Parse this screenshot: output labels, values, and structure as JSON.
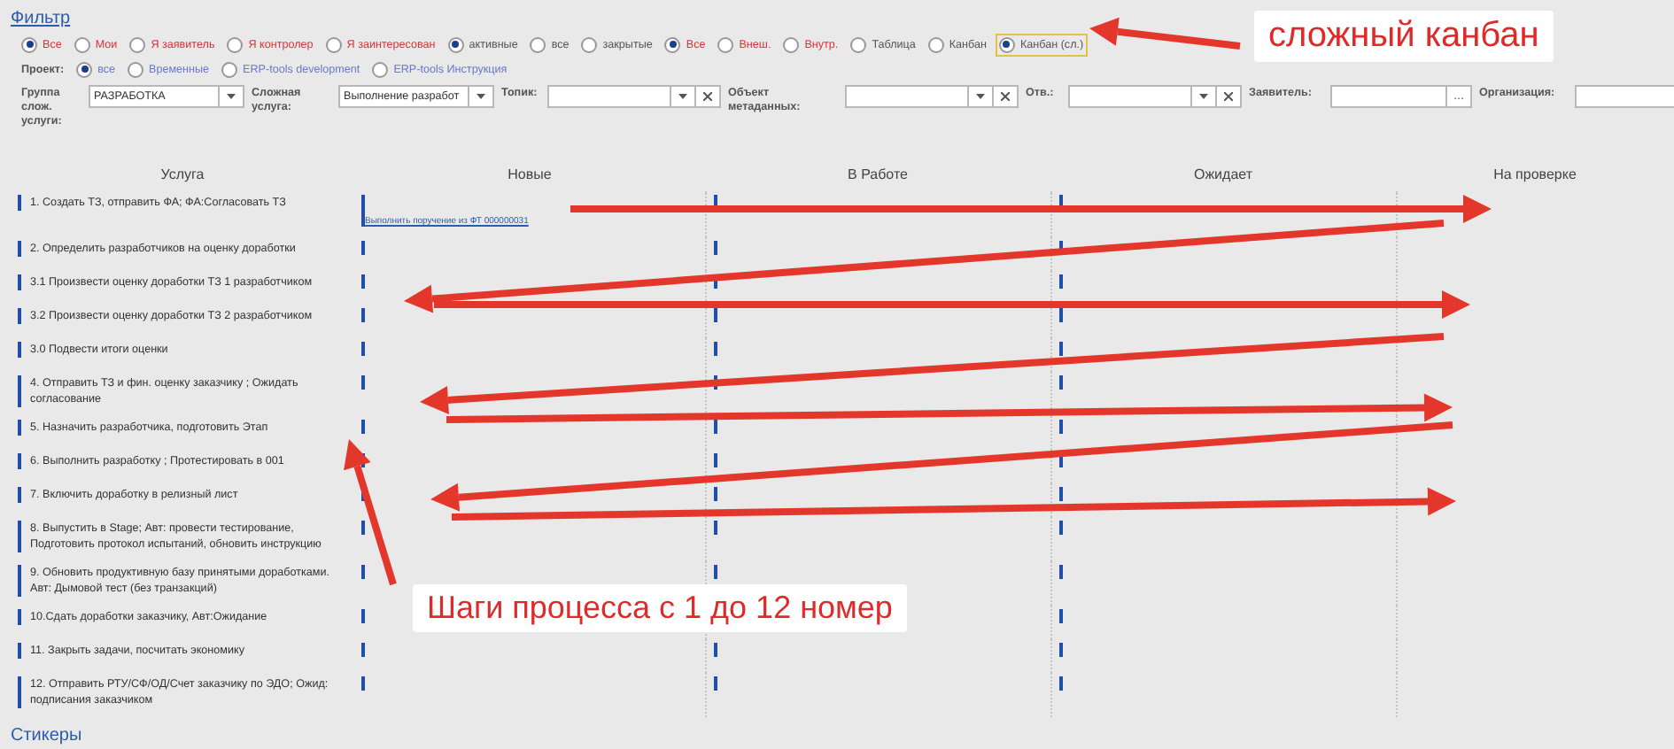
{
  "filter": {
    "title": "Фильтр",
    "radio_groups": [
      {
        "kind": "alert",
        "options": [
          {
            "label": "Все",
            "selected": true
          },
          {
            "label": "Мои",
            "selected": false
          },
          {
            "label": "Я заявитель",
            "selected": false
          },
          {
            "label": "Я контролер",
            "selected": false
          },
          {
            "label": "Я заинтересован",
            "selected": false
          }
        ]
      },
      {
        "kind": "plain",
        "options": [
          {
            "label": "активные",
            "selected": true
          },
          {
            "label": "все",
            "selected": false
          },
          {
            "label": "закрытые",
            "selected": false
          }
        ]
      },
      {
        "kind": "alert",
        "options": [
          {
            "label": "Все",
            "selected": true
          },
          {
            "label": "Внеш.",
            "selected": false
          },
          {
            "label": "Внутр.",
            "selected": false
          }
        ]
      },
      {
        "kind": "view",
        "options": [
          {
            "label": "Таблица",
            "selected": false
          },
          {
            "label": "Канбан",
            "selected": false
          },
          {
            "label": "Канбан (сл.)",
            "selected": true
          }
        ]
      }
    ],
    "project": {
      "label": "Проект:",
      "options": [
        {
          "label": "все",
          "selected": true
        },
        {
          "label": "Временные",
          "selected": false
        },
        {
          "label": "ERP-tools development",
          "selected": false
        },
        {
          "label": "ERP-tools Инструкция",
          "selected": false
        }
      ]
    },
    "fields": [
      {
        "kind": "select",
        "label": "Группа слож. услуги:",
        "value": "РАЗРАБОТКА"
      },
      {
        "kind": "select",
        "label": "Сложная услуга:",
        "value": "Выполнение разработ"
      },
      {
        "kind": "combo",
        "label": "Топик:"
      },
      {
        "kind": "combo",
        "label": "Объект метаданных:"
      },
      {
        "kind": "combo",
        "label": "Отв.:"
      },
      {
        "kind": "picker",
        "label": "Заявитель:",
        "button": "..."
      },
      {
        "kind": "text",
        "label": "Организация:"
      }
    ]
  },
  "board": {
    "columns": [
      "Услуга",
      "Новые",
      "В Работе",
      "Ожидает",
      "На проверке"
    ],
    "rows": [
      {
        "service": "1. Создать ТЗ, отправить ФА; ФА:Согласовать ТЗ",
        "new_card": "Выполнить поручение из ФТ 000000031"
      },
      {
        "service": "2. Определить разработчиков на оценку доработки"
      },
      {
        "service": "3.1 Произвести оценку доработки ТЗ 1 разработчиком"
      },
      {
        "service": "3.2 Произвести оценку доработки ТЗ 2 разработчиком"
      },
      {
        "service": "3.0 Подвести итоги оценки"
      },
      {
        "service": "4. Отправить ТЗ и фин. оценку заказчику ; Ожидать согласование"
      },
      {
        "service": "5. Назначить разработчика, подготовить Этап"
      },
      {
        "service": "6. Выполнить разработку ; Протестировать в 001"
      },
      {
        "service": "7. Включить доработку в релизный лист"
      },
      {
        "service": "8. Выпустить в Stage; Авт: провести тестирование, Подготовить протокол испытаний, обновить инструкцию"
      },
      {
        "service": "9. Обновить продуктивную базу принятыми доработками. Авт: Дымовой тест (без транзакций)"
      },
      {
        "service": "10.Сдать доработки заказчику, Авт:Ожидание"
      },
      {
        "service": "11. Закрыть задачи, посчитать экономику"
      },
      {
        "service": "12. Отправить РТУ/СФ/ОД/Счет заказчику по ЭДО; Ожид: подписания заказчиком"
      }
    ]
  },
  "stickers": {
    "title": "Стикеры"
  },
  "callouts": [
    {
      "text": "сложный канбан"
    },
    {
      "text": "Шаги процесса с 1 до 12 номер"
    }
  ]
}
